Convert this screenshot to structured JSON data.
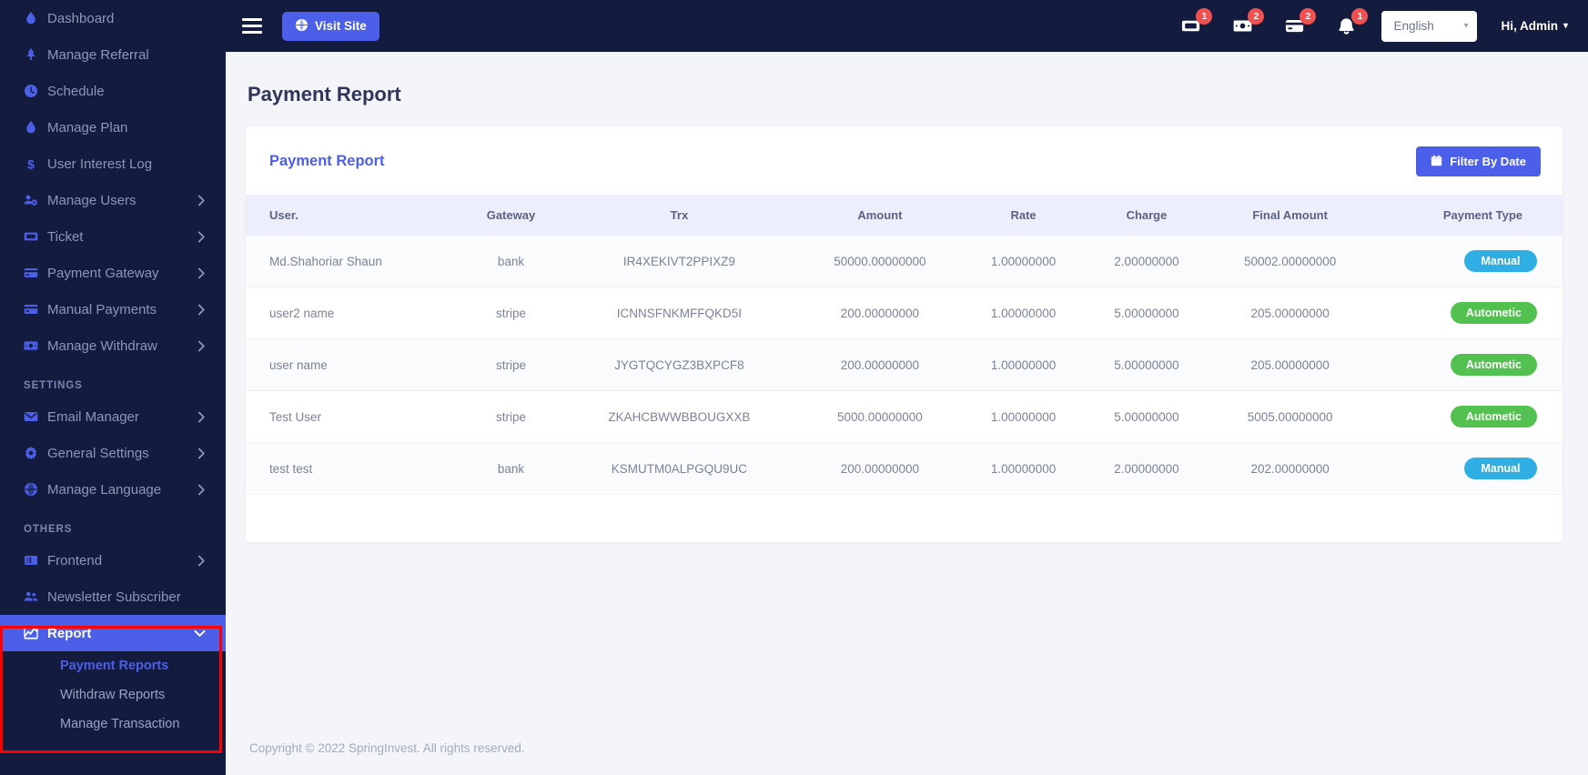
{
  "sidebar": {
    "items": [
      {
        "label": "Dashboard",
        "icon": "water-drop-icon",
        "has_children": false
      },
      {
        "label": "Manage Referral",
        "icon": "tree-icon",
        "has_children": false
      },
      {
        "label": "Schedule",
        "icon": "clock-icon",
        "has_children": false
      },
      {
        "label": "Manage Plan",
        "icon": "water-drop-icon",
        "has_children": false
      },
      {
        "label": "User Interest Log",
        "icon": "dollar-icon",
        "has_children": false
      },
      {
        "label": "Manage Users",
        "icon": "users-gear-icon",
        "has_children": true
      },
      {
        "label": "Ticket",
        "icon": "ticket-icon",
        "has_children": true
      },
      {
        "label": "Payment Gateway",
        "icon": "credit-card-icon",
        "has_children": true
      },
      {
        "label": "Manual Payments",
        "icon": "credit-card-icon",
        "has_children": true
      },
      {
        "label": "Manage Withdraw",
        "icon": "money-bill-icon",
        "has_children": true
      }
    ],
    "settings_heading": "SETTINGS",
    "settings_items": [
      {
        "label": "Email Manager",
        "icon": "envelope-icon",
        "has_children": true
      },
      {
        "label": "General Settings",
        "icon": "gear-icon",
        "has_children": true
      },
      {
        "label": "Manage Language",
        "icon": "globe-icon",
        "has_children": true
      }
    ],
    "others_heading": "OTHERS",
    "others_items": [
      {
        "label": "Frontend",
        "icon": "layout-icon",
        "has_children": true
      },
      {
        "label": "Newsletter Subscriber",
        "icon": "users-icon",
        "has_children": false
      }
    ],
    "report": {
      "label": "Report",
      "icon": "chart-line-icon",
      "expanded": true,
      "children": [
        {
          "label": "Payment Reports",
          "current": true
        },
        {
          "label": "Withdraw Reports",
          "current": false
        },
        {
          "label": "Manage Transaction",
          "current": false
        }
      ]
    },
    "active_color": "#4c5fe8",
    "background_color": "#131b3f",
    "annotation_color": "#ff0000"
  },
  "topbar": {
    "menu_icon": "hamburger-icon",
    "visit_site_label": "Visit Site",
    "visit_site_icon": "globe-icon",
    "icons": [
      {
        "name": "ticket-icon",
        "badge": "1"
      },
      {
        "name": "money-bill-icon",
        "badge": "2"
      },
      {
        "name": "credit-card-icon",
        "badge": "2"
      },
      {
        "name": "bell-icon",
        "badge": "1"
      }
    ],
    "language": "English",
    "admin_label": "Hi, Admin",
    "badge_color": "#f0504f"
  },
  "page": {
    "title": "Payment Report",
    "card_title": "Payment Report",
    "filter_button": "Filter By Date",
    "filter_icon": "calendar-icon"
  },
  "table": {
    "columns": [
      "User.",
      "Gateway",
      "Trx",
      "Amount",
      "Rate",
      "Charge",
      "Final Amount",
      "Payment Type"
    ],
    "rows": [
      {
        "user": "Md.Shahoriar Shaun",
        "gateway": "bank",
        "trx": "IR4XEKIVT2PPIXZ9",
        "amount": "50000.00000000",
        "rate": "1.00000000",
        "charge": "2.00000000",
        "final_amount": "50002.00000000",
        "payment_type": "Manual",
        "payment_type_style": "manual"
      },
      {
        "user": "user2 name",
        "gateway": "stripe",
        "trx": "ICNNSFNKMFFQKD5I",
        "amount": "200.00000000",
        "rate": "1.00000000",
        "charge": "5.00000000",
        "final_amount": "205.00000000",
        "payment_type": "Autometic",
        "payment_type_style": "auto"
      },
      {
        "user": "user name",
        "gateway": "stripe",
        "trx": "JYGTQCYGZ3BXPCF8",
        "amount": "200.00000000",
        "rate": "1.00000000",
        "charge": "5.00000000",
        "final_amount": "205.00000000",
        "payment_type": "Autometic",
        "payment_type_style": "auto"
      },
      {
        "user": "Test User",
        "gateway": "stripe",
        "trx": "ZKAHCBWWBBOUGXXB",
        "amount": "5000.00000000",
        "rate": "1.00000000",
        "charge": "5.00000000",
        "final_amount": "5005.00000000",
        "payment_type": "Autometic",
        "payment_type_style": "auto"
      },
      {
        "user": "test test",
        "gateway": "bank",
        "trx": "KSMUTM0ALPGQU9UC",
        "amount": "200.00000000",
        "rate": "1.00000000",
        "charge": "2.00000000",
        "final_amount": "202.00000000",
        "payment_type": "Manual",
        "payment_type_style": "manual"
      }
    ]
  },
  "footer": {
    "copyright": "Copyright © 2022 SpringInvest. All rights reserved."
  }
}
